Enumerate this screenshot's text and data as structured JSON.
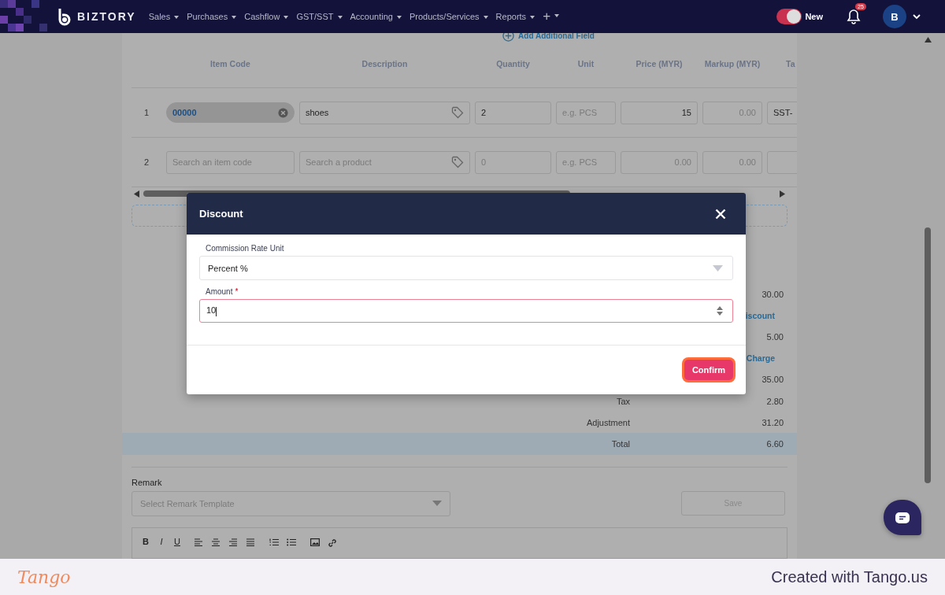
{
  "navbar": {
    "brand": "BIZTORY",
    "menu": [
      {
        "label": "Sales"
      },
      {
        "label": "Purchases"
      },
      {
        "label": "Cashflow"
      },
      {
        "label": "GST/SST"
      },
      {
        "label": "Accounting"
      },
      {
        "label": "Products/Services"
      },
      {
        "label": "Reports"
      },
      {
        "label": "+"
      }
    ],
    "toggle": {
      "label": "New",
      "on": true
    },
    "notifications": "25",
    "avatar": "B"
  },
  "add_field": "Add Additional Field",
  "table": {
    "columns": [
      "Item Code",
      "Description",
      "Quantity",
      "Unit",
      "Price (MYR)",
      "Markup (MYR)",
      "Ta"
    ],
    "rows": [
      {
        "no": "1",
        "item_code": {
          "value": "00000",
          "selected": true
        },
        "description": {
          "value": "shoes"
        },
        "quantity": {
          "value": "2"
        },
        "unit": {
          "placeholder": "e.g. PCS"
        },
        "price": {
          "value": "15"
        },
        "markup": {
          "placeholder": "0.00"
        },
        "tax": {
          "value": "SST-"
        }
      },
      {
        "no": "2",
        "item_code": {
          "placeholder": "Search an item code",
          "selected": false
        },
        "description": {
          "placeholder": "Search a product"
        },
        "quantity": {
          "placeholder": "0"
        },
        "unit": {
          "placeholder": "e.g. PCS"
        },
        "price": {
          "placeholder": "0.00"
        },
        "markup": {
          "placeholder": "0.00"
        },
        "tax": {}
      }
    ]
  },
  "summary": [
    {
      "kind": "value",
      "value": "30.00"
    },
    {
      "kind": "link",
      "label": "iscount"
    },
    {
      "kind": "value",
      "value": "5.00"
    },
    {
      "kind": "link",
      "label": "Charge"
    },
    {
      "kind": "value",
      "value": "35.00"
    },
    {
      "kind": "value",
      "label": "Tax",
      "value": "2.80"
    },
    {
      "kind": "value",
      "label": "Adjustment",
      "value": "31.20"
    },
    {
      "kind": "total",
      "label": "Total",
      "value": "6.60"
    }
  ],
  "remark": {
    "label": "Remark",
    "placeholder": "Select Remark Template",
    "save": "Save",
    "toolbar": [
      "B",
      "I",
      "U"
    ]
  },
  "dialog": {
    "title": "Discount",
    "fields": [
      {
        "kind": "select",
        "label": "Commission Rate Unit",
        "value": "Percent %"
      },
      {
        "kind": "number",
        "label": "Amount",
        "required_mark": "*",
        "value": "10"
      }
    ],
    "confirm": "Confirm"
  },
  "footer": {
    "logo": "Tango",
    "credit": "Created with Tango.us"
  }
}
